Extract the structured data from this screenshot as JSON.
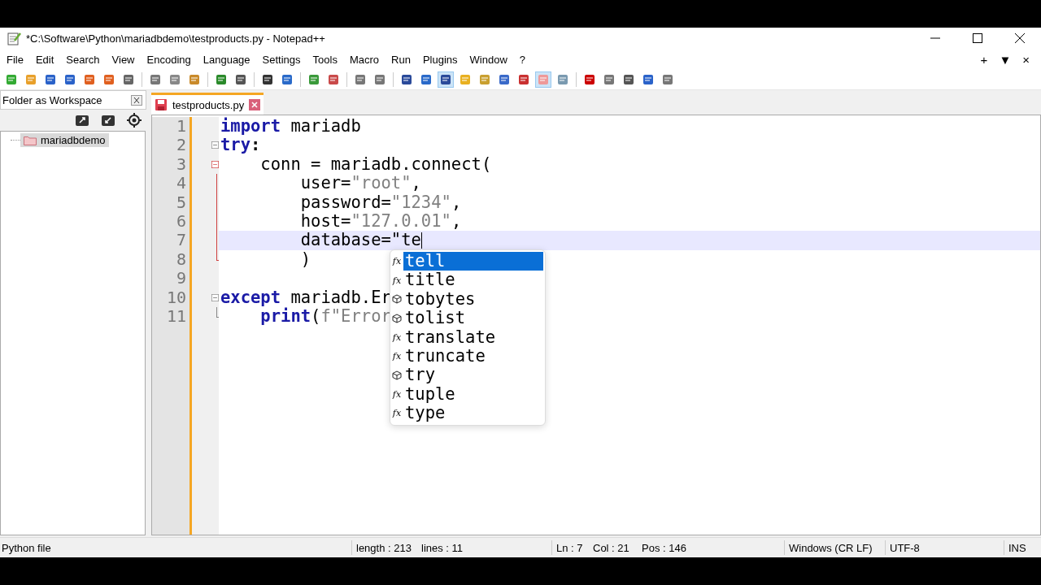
{
  "window": {
    "title": "*C:\\Software\\Python\\mariadbdemo\\testproducts.py - Notepad++"
  },
  "menu": [
    "File",
    "Edit",
    "Search",
    "View",
    "Encoding",
    "Language",
    "Settings",
    "Tools",
    "Macro",
    "Run",
    "Plugins",
    "Window",
    "?"
  ],
  "toolbar": [
    [
      {
        "pressed": false
      },
      {
        "pressed": false
      },
      {
        "pressed": false
      },
      {
        "pressed": false
      },
      {
        "pressed": false
      },
      {
        "pressed": false
      },
      {
        "pressed": false
      }
    ],
    [
      {
        "pressed": false
      },
      {
        "pressed": false
      },
      {
        "pressed": false
      }
    ],
    [
      {
        "pressed": false
      },
      {
        "pressed": false
      }
    ],
    [
      {
        "pressed": false
      },
      {
        "pressed": false
      }
    ],
    [
      {
        "pressed": false
      },
      {
        "pressed": false
      }
    ],
    [
      {
        "pressed": false
      },
      {
        "pressed": false
      }
    ],
    [
      {
        "pressed": false
      },
      {
        "pressed": false
      },
      {
        "pressed": true
      },
      {
        "pressed": false
      },
      {
        "pressed": false
      },
      {
        "pressed": false
      },
      {
        "pressed": false
      },
      {
        "pressed": true
      },
      {
        "pressed": false
      }
    ],
    [
      {
        "pressed": false
      },
      {
        "pressed": false
      },
      {
        "pressed": false
      },
      {
        "pressed": false
      },
      {
        "pressed": false
      }
    ]
  ],
  "menu_right": [
    "+",
    "▼",
    "×"
  ],
  "panel": {
    "title": "Folder as Workspace",
    "items": [
      {
        "label": "mariadbdemo",
        "selected": true
      }
    ]
  },
  "tab": {
    "label": "testproducts.py",
    "selected": true,
    "modified": true
  },
  "lines": [
    {
      "number": "1",
      "kind": "none",
      "current": false,
      "tokens": [
        {
          "kind": "keyword",
          "text": "import"
        },
        {
          "kind": "plain",
          "text": " mariadb"
        }
      ]
    },
    {
      "number": "2",
      "kind": "head",
      "current": false,
      "tokens": [
        {
          "kind": "keyword",
          "text": "try"
        },
        {
          "kind": "operator",
          "text": ":"
        }
      ]
    },
    {
      "number": "3",
      "kind": "head-active",
      "current": false,
      "tokens": [
        {
          "kind": "plain",
          "text": "    conn = mariadb.connect("
        }
      ]
    },
    {
      "number": "4",
      "kind": "body-active",
      "current": false,
      "tokens": [
        {
          "kind": "plain",
          "text": "        user="
        },
        {
          "kind": "string",
          "text": "\"root\""
        },
        {
          "kind": "plain",
          "text": ","
        }
      ]
    },
    {
      "number": "5",
      "kind": "body-active",
      "current": false,
      "tokens": [
        {
          "kind": "plain",
          "text": "        password="
        },
        {
          "kind": "string",
          "text": "\"1234\""
        },
        {
          "kind": "plain",
          "text": ","
        }
      ]
    },
    {
      "number": "6",
      "kind": "body-active",
      "current": false,
      "tokens": [
        {
          "kind": "plain",
          "text": "        host="
        },
        {
          "kind": "string",
          "text": "\"127.0.01\""
        },
        {
          "kind": "plain",
          "text": ","
        }
      ]
    },
    {
      "number": "7",
      "kind": "body-active",
      "current": true,
      "tokens": [
        {
          "kind": "plain",
          "text": "        database=\"te"
        }
      ]
    },
    {
      "number": "8",
      "kind": "end-active",
      "current": false,
      "tokens": [
        {
          "kind": "plain",
          "text": "        )"
        }
      ]
    },
    {
      "number": "9",
      "kind": "none",
      "current": false
    },
    {
      "number": "10",
      "kind": "head",
      "current": false,
      "tokens": [
        {
          "kind": "keyword",
          "text": "except"
        },
        {
          "kind": "plain",
          "text": " mariadb.Er"
        }
      ]
    },
    {
      "number": "11",
      "kind": "end",
      "current": false,
      "tokens": [
        {
          "kind": "keyword",
          "text": "    print"
        },
        {
          "kind": "plain",
          "text": "("
        },
        {
          "kind": "string",
          "text": "f\"Error"
        }
      ]
    }
  ],
  "autocomplete": [
    {
      "label": "tell",
      "kind": "function",
      "icon_text": "fx",
      "selected": true
    },
    {
      "label": "title",
      "kind": "function",
      "icon_text": "fx",
      "selected": false
    },
    {
      "label": "tobytes",
      "kind": "keyword",
      "selected": false
    },
    {
      "label": "tolist",
      "kind": "keyword",
      "selected": false
    },
    {
      "label": "translate",
      "kind": "function",
      "icon_text": "fx",
      "selected": false
    },
    {
      "label": "truncate",
      "kind": "function",
      "icon_text": "fx",
      "selected": false
    },
    {
      "label": "try",
      "kind": "keyword",
      "selected": false
    },
    {
      "label": "tuple",
      "kind": "function",
      "icon_text": "fx",
      "selected": false
    },
    {
      "label": "type",
      "kind": "function",
      "icon_text": "fx",
      "selected": false
    }
  ],
  "status_bar": {
    "file_type": "Python file",
    "length": "length : 213",
    "lines": "lines : 11",
    "ln": "Ln : 7",
    "col": "Col : 21",
    "pos": "Pos : 146",
    "eol": "Windows (CR LF)",
    "encoding": "UTF-8",
    "mode": "INS"
  }
}
